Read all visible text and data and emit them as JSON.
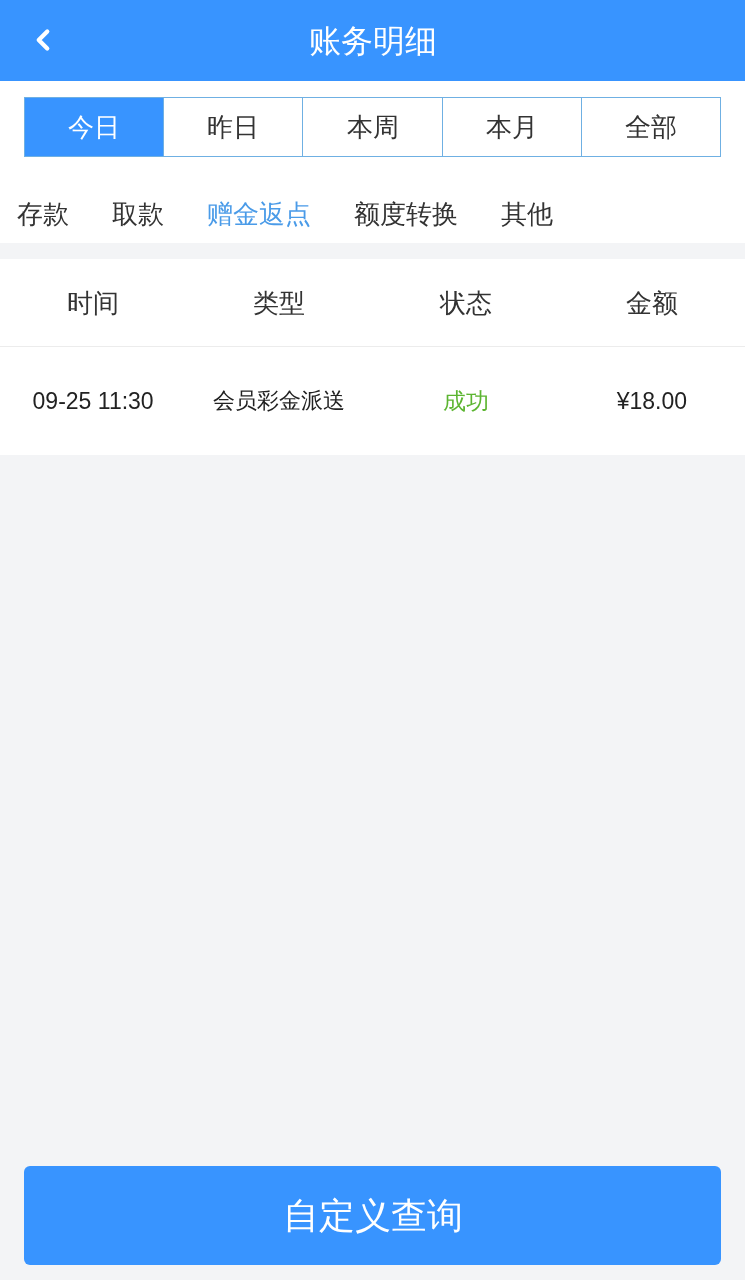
{
  "header": {
    "title": "账务明细"
  },
  "period_tabs": [
    {
      "label": "今日",
      "selected": true
    },
    {
      "label": "昨日",
      "selected": false
    },
    {
      "label": "本周",
      "selected": false
    },
    {
      "label": "本月",
      "selected": false
    },
    {
      "label": "全部",
      "selected": false
    }
  ],
  "category_tabs": [
    {
      "label": "存款",
      "selected": false
    },
    {
      "label": "取款",
      "selected": false
    },
    {
      "label": "赠金返点",
      "selected": true
    },
    {
      "label": "额度转换",
      "selected": false
    },
    {
      "label": "其他",
      "selected": false
    }
  ],
  "table": {
    "columns": [
      "时间",
      "类型",
      "状态",
      "金额"
    ],
    "rows": [
      {
        "time": "09-25 11:30",
        "type": "会员彩金派送",
        "status": {
          "text": "成功",
          "kind": "success"
        },
        "amount": "¥18.00"
      }
    ]
  },
  "query_button": {
    "label": "自定义查询"
  }
}
